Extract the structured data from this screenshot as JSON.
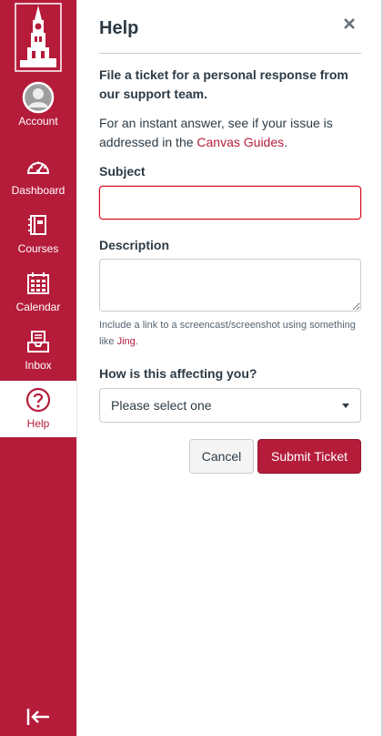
{
  "colors": {
    "brand": "#b51c3a",
    "text": "#2d3b45",
    "error_border": "#d5091c"
  },
  "logo": {
    "alt": ""
  },
  "nav": {
    "items": [
      {
        "key": "account",
        "label": "Account",
        "icon": "avatar-icon"
      },
      {
        "key": "dashboard",
        "label": "Dashboard",
        "icon": "dashboard-icon"
      },
      {
        "key": "courses",
        "label": "Courses",
        "icon": "courses-icon"
      },
      {
        "key": "calendar",
        "label": "Calendar",
        "icon": "calendar-icon"
      },
      {
        "key": "inbox",
        "label": "Inbox",
        "icon": "inbox-icon"
      },
      {
        "key": "help",
        "label": "Help",
        "icon": "help-icon",
        "active": true
      }
    ],
    "collapse_icon": "collapse-sidebar-icon"
  },
  "panel": {
    "title": "Help",
    "lead": "File a ticket for a personal response from our support team.",
    "info_prefix": "For an instant answer, see if your issue is addressed in the ",
    "info_link": "Canvas Guides",
    "info_suffix": ".",
    "subject": {
      "label": "Subject",
      "value": ""
    },
    "description": {
      "label": "Description",
      "value": ""
    },
    "hint_prefix": "Include a link to a screencast/screenshot using something like ",
    "hint_link": "Jing",
    "hint_suffix": ".",
    "impact": {
      "label": "How is this affecting you?",
      "selected": "Please select one"
    },
    "cancel_label": "Cancel",
    "submit_label": "Submit Ticket"
  }
}
